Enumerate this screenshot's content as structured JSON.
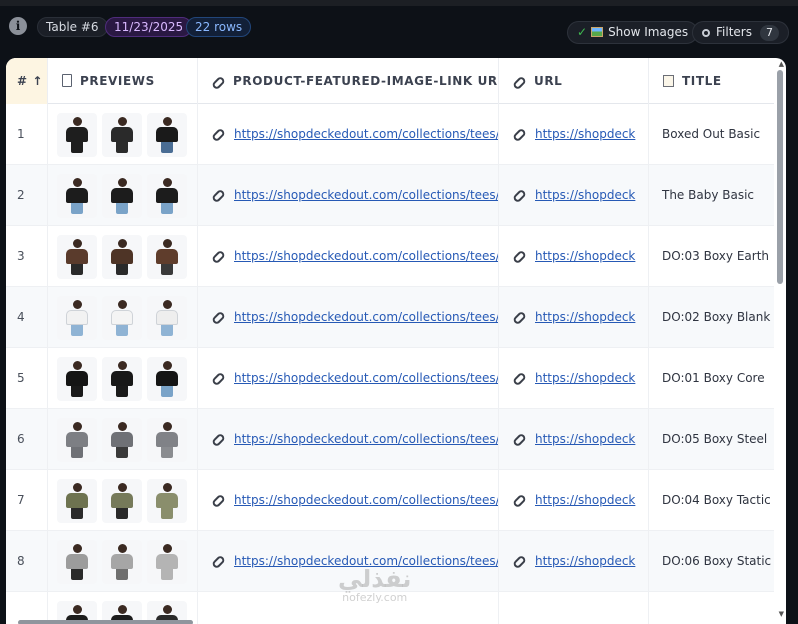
{
  "toolbar": {
    "info_glyph": "i",
    "table_label": "Table #6",
    "date_label": "11/23/2025",
    "rows_label": "22 rows",
    "show_images_label": "Show Images",
    "show_images_check": "✓",
    "filters_label": "Filters",
    "filters_count": "7"
  },
  "columns": {
    "num": "# ↑",
    "previews": "PREVIEWS",
    "link": "PRODUCT-FEATURED-IMAGE-LINK URL",
    "url": "URL",
    "title": "TITLE"
  },
  "rows": [
    {
      "num": "1",
      "link": "https://shopdeckedout.com/collections/tees/",
      "url": "https://shopdeck",
      "title": "Boxed Out Basic",
      "shirt_colors": [
        "#1e1e1e",
        "#2a2a2a",
        "#1a1a1a"
      ],
      "leg_colors": [
        "#1e1e1e",
        "#2b2b2b",
        "#4a6d94"
      ]
    },
    {
      "num": "2",
      "link": "https://shopdeckedout.com/collections/tees/",
      "url": "https://shopdeck",
      "title": "The Baby Basic",
      "shirt_colors": [
        "#1c1c1c",
        "#1c1c1c",
        "#1c1c1c"
      ],
      "leg_colors": [
        "#7aa3c8",
        "#7aa3c8",
        "#7aa3c8"
      ]
    },
    {
      "num": "3",
      "link": "https://shopdeckedout.com/collections/tees/",
      "url": "https://shopdeck",
      "title": "DO:03 Boxy Earth",
      "shirt_colors": [
        "#5a3b2c",
        "#4e3426",
        "#5f3d2c"
      ],
      "leg_colors": [
        "#2a2a2a",
        "#2a2a2a",
        "#3a3a3a"
      ]
    },
    {
      "num": "4",
      "link": "https://shopdeckedout.com/collections/tees/",
      "url": "https://shopdeck",
      "title": "DO:02 Boxy Blank",
      "shirt_colors": [
        "#f2f2f2",
        "#f4f4f4",
        "#eeeeee"
      ],
      "leg_colors": [
        "#8fb3d4",
        "#8fb3d4",
        "#8fb3d4"
      ]
    },
    {
      "num": "5",
      "link": "https://shopdeckedout.com/collections/tees/",
      "url": "https://shopdeck",
      "title": "DO:01 Boxy Core",
      "shirt_colors": [
        "#151515",
        "#181818",
        "#151515"
      ],
      "leg_colors": [
        "#1a1a1a",
        "#1a1a1a",
        "#7aa3c8"
      ]
    },
    {
      "num": "6",
      "link": "https://shopdeckedout.com/collections/tees/",
      "url": "https://shopdeck",
      "title": "DO:05 Boxy Steel",
      "shirt_colors": [
        "#7d7f84",
        "#6f7176",
        "#808287"
      ],
      "leg_colors": [
        "#6f7176",
        "#3a3a3a",
        "#8a8c90"
      ]
    },
    {
      "num": "7",
      "link": "https://shopdeckedout.com/collections/tees/",
      "url": "https://shopdeck",
      "title": "DO:04 Boxy Tactic",
      "shirt_colors": [
        "#6e7350",
        "#767a5a",
        "#8a8e6c"
      ],
      "leg_colors": [
        "#2a2a2a",
        "#2a2a2a",
        "#8a8e6c"
      ]
    },
    {
      "num": "8",
      "link": "https://shopdeckedout.com/collections/tees/",
      "url": "https://shopdeck",
      "title": "DO:06 Boxy Static",
      "shirt_colors": [
        "#9c9c9c",
        "#a6a6a6",
        "#b4b4b4"
      ],
      "leg_colors": [
        "#2a2a2a",
        "#6f6f6f",
        "#b4b4b4"
      ]
    },
    {
      "num": "",
      "link": "",
      "url": "",
      "title": "",
      "shirt_colors": [
        "#1c1c1c",
        "#1c1c1c",
        "#2a2a2a"
      ],
      "leg_colors": [
        "#1c1c1c",
        "#1c1c1c",
        "#2a2a2a"
      ]
    }
  ],
  "watermark": {
    "arabic": "نفذلي",
    "latin": "nofezly.com"
  }
}
